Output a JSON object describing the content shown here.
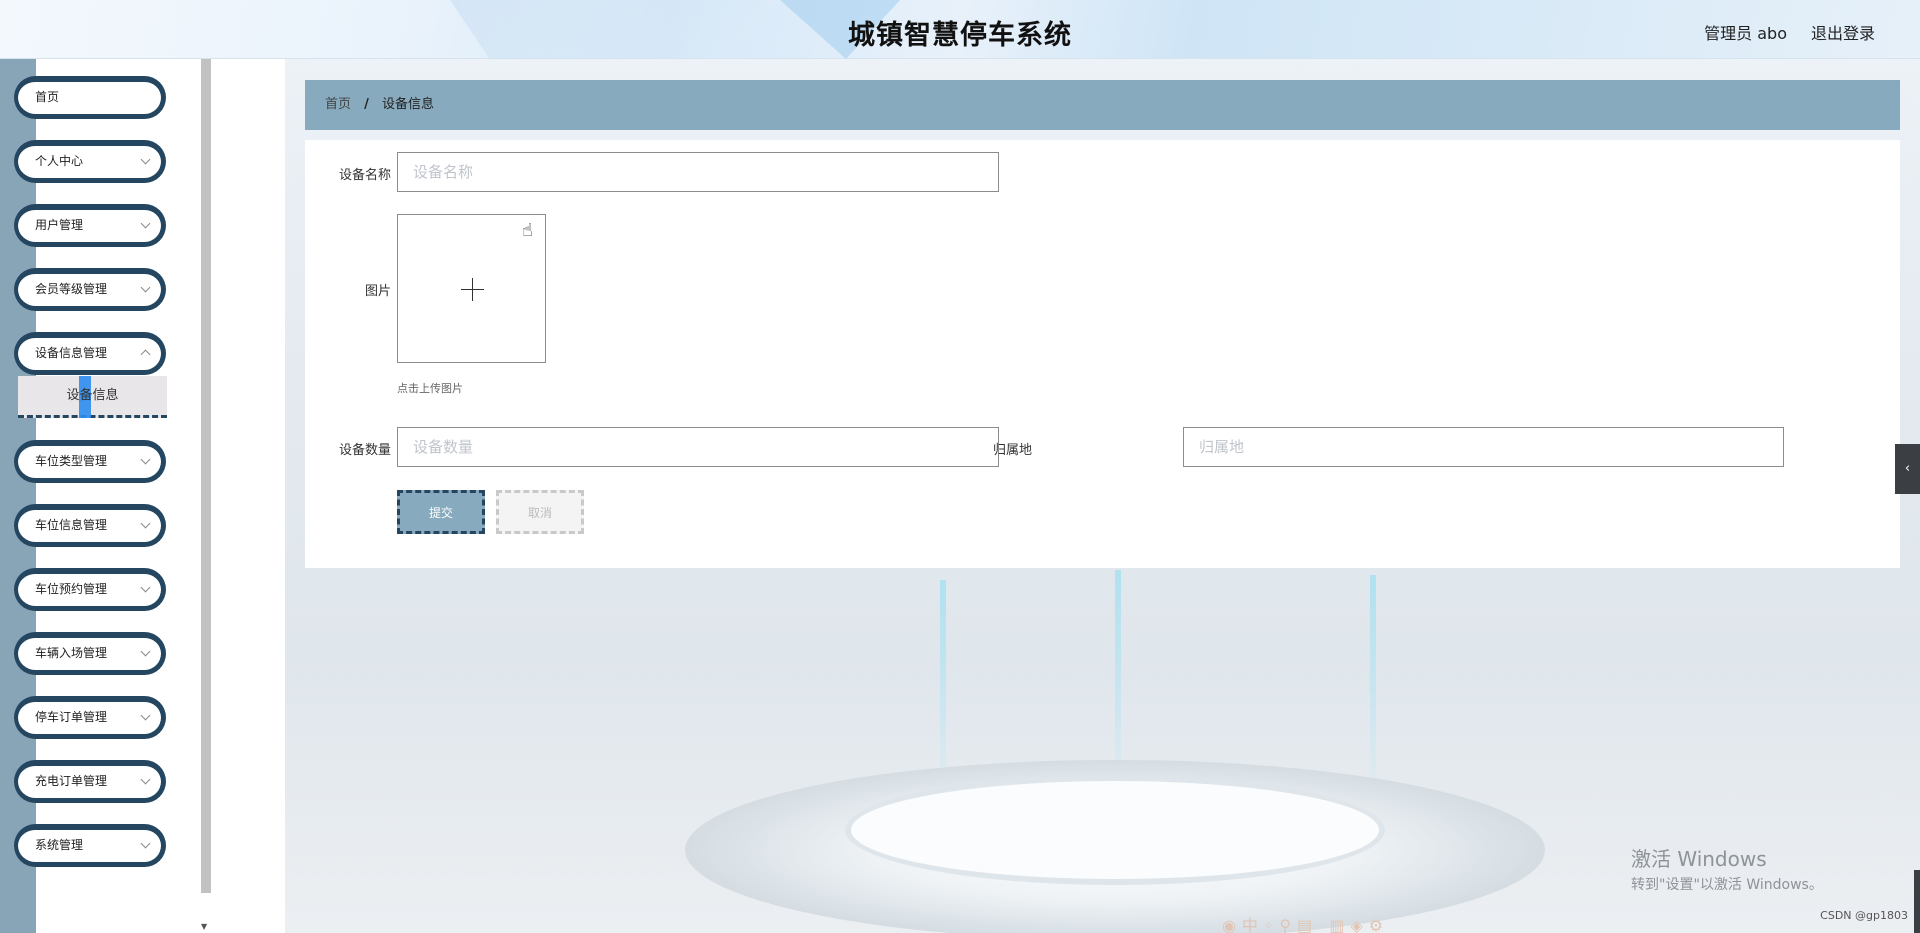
{
  "header": {
    "title": "城镇智慧停车系统",
    "user_label": "管理员 abo",
    "logout_label": "退出登录"
  },
  "sidebar": {
    "items": [
      {
        "label": "首页",
        "has_chevron": false
      },
      {
        "label": "个人中心",
        "has_chevron": true
      },
      {
        "label": "用户管理",
        "has_chevron": true
      },
      {
        "label": "会员等级管理",
        "has_chevron": true
      },
      {
        "label": "设备信息管理",
        "has_chevron": true
      },
      {
        "label": "车位类型管理",
        "has_chevron": true
      },
      {
        "label": "车位信息管理",
        "has_chevron": true
      },
      {
        "label": "车位预约管理",
        "has_chevron": true
      },
      {
        "label": "车辆入场管理",
        "has_chevron": true
      },
      {
        "label": "停车订单管理",
        "has_chevron": true
      },
      {
        "label": "充电订单管理",
        "has_chevron": true
      },
      {
        "label": "系统管理",
        "has_chevron": true
      }
    ],
    "active_subitem": "设备信息"
  },
  "breadcrumb": {
    "home": "首页",
    "separator": "/",
    "current": "设备信息"
  },
  "form": {
    "device_name": {
      "label": "设备名称",
      "placeholder": "设备名称",
      "value": ""
    },
    "image": {
      "label": "图片",
      "tip": "点击上传图片"
    },
    "device_quantity": {
      "label": "设备数量",
      "placeholder": "设备数量",
      "value": ""
    },
    "location": {
      "label": "归属地",
      "placeholder": "归属地",
      "value": ""
    },
    "submit_label": "提交",
    "cancel_label": "取消"
  },
  "overlay": {
    "side_tab_icon": "‹",
    "windows_line1": "激活 Windows",
    "windows_line2": "转到\"设置\"以激活 Windows。",
    "csdn": "CSDN @gp1803"
  },
  "colors": {
    "accent": "#88aabe",
    "accent_dark": "#244660",
    "rail": "#88a5b7"
  }
}
